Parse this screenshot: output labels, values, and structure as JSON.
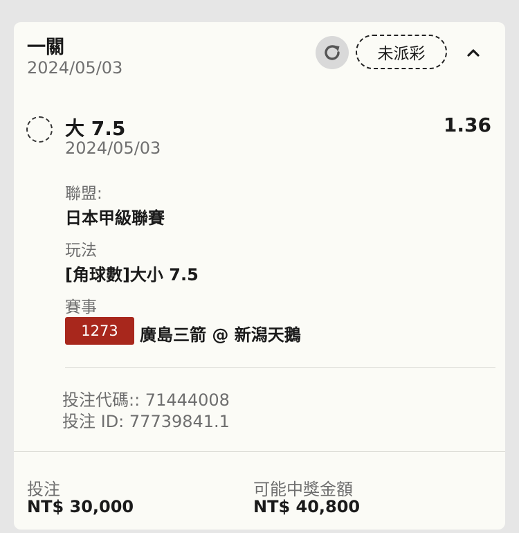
{
  "header": {
    "bet_type": "一關",
    "date": "2024/05/03",
    "status": "未派彩",
    "refresh_icon": "refresh-icon",
    "collapse_icon": "chevron-up-icon"
  },
  "selection": {
    "name": "大 7.5",
    "date": "2024/05/03",
    "odds": "1.36",
    "league_label": "聯盟:",
    "league": "日本甲級聯賽",
    "market_label": "玩法",
    "market": "[角球數]大小 7.5",
    "event_label": "賽事",
    "match_code": "1273",
    "event": "廣島三箭 @ 新潟天鵝"
  },
  "bet_info": {
    "code_line": "投注代碼:: 71444008",
    "id_line": "投注 ID: 77739841.1"
  },
  "footer": {
    "stake_label": "投注",
    "stake_value": "NT$ 30,000",
    "payout_label": "可能中獎金額",
    "payout_value": "NT$ 40,800"
  },
  "colors": {
    "match_code_bg": "#a8271c",
    "card_bg": "#fbfbf6",
    "page_bg": "#e6e6e6"
  }
}
